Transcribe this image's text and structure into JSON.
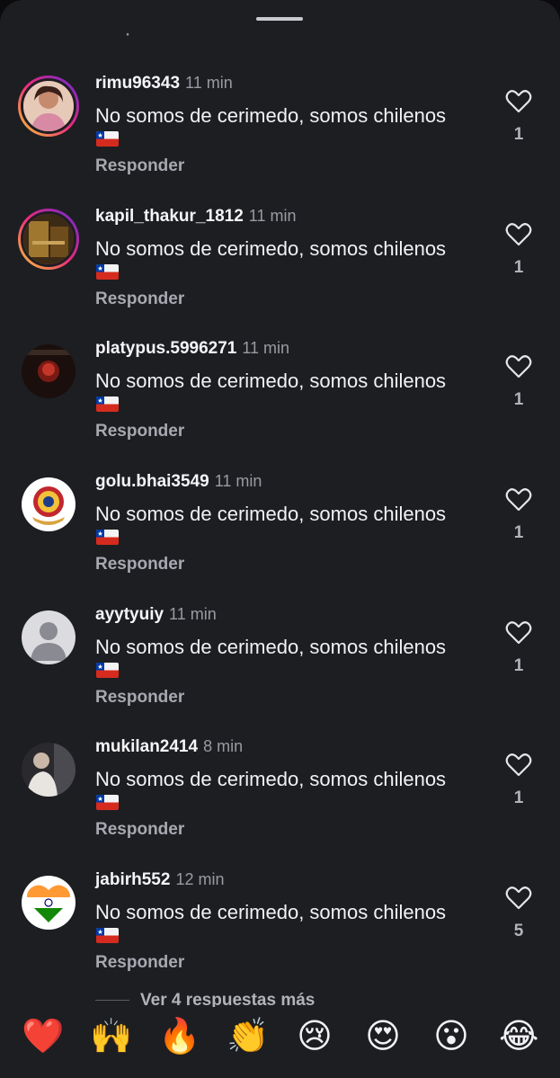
{
  "header": {
    "grabber": "drag-handle"
  },
  "comments": [
    {
      "username": "rimu96343",
      "time": "11 min",
      "text": "No somos de cerimedo, somos chilenos",
      "flag": "chile-flag-icon",
      "reply": "Responder",
      "likes": "1"
    },
    {
      "username": "kapil_thakur_1812",
      "time": "11 min",
      "text": "No somos de cerimedo, somos chilenos",
      "flag": "chile-flag-icon",
      "reply": "Responder",
      "likes": "1"
    },
    {
      "username": "platypus.5996271",
      "time": "11 min",
      "text": "No somos de cerimedo, somos chilenos",
      "flag": "chile-flag-icon",
      "reply": "Responder",
      "likes": "1"
    },
    {
      "username": "golu.bhai3549",
      "time": "11 min",
      "text": "No somos de cerimedo, somos chilenos",
      "flag": "chile-flag-icon",
      "reply": "Responder",
      "likes": "1"
    },
    {
      "username": "ayytyuiy",
      "time": "11 min",
      "text": "No somos de cerimedo, somos chilenos",
      "flag": "chile-flag-icon",
      "reply": "Responder",
      "likes": "1"
    },
    {
      "username": "mukilan2414",
      "time": "8 min",
      "text": "No somos de cerimedo, somos chilenos",
      "flag": "chile-flag-icon",
      "reply": "Responder",
      "likes": "1"
    },
    {
      "username": "jabirh552",
      "time": "12 min",
      "text": "No somos de cerimedo, somos chilenos",
      "flag": "chile-flag-icon",
      "reply": "Responder",
      "likes": "5"
    }
  ],
  "more_replies": "Ver 4 respuestas más",
  "reactions": [
    "❤️",
    "🙌",
    "🔥",
    "👏",
    "😢",
    "😍",
    "😮",
    "😂"
  ],
  "colors": {
    "background": "#1d1e22",
    "reply_text": "#a8a8b0",
    "heart_outline": "#e6e6ea"
  }
}
